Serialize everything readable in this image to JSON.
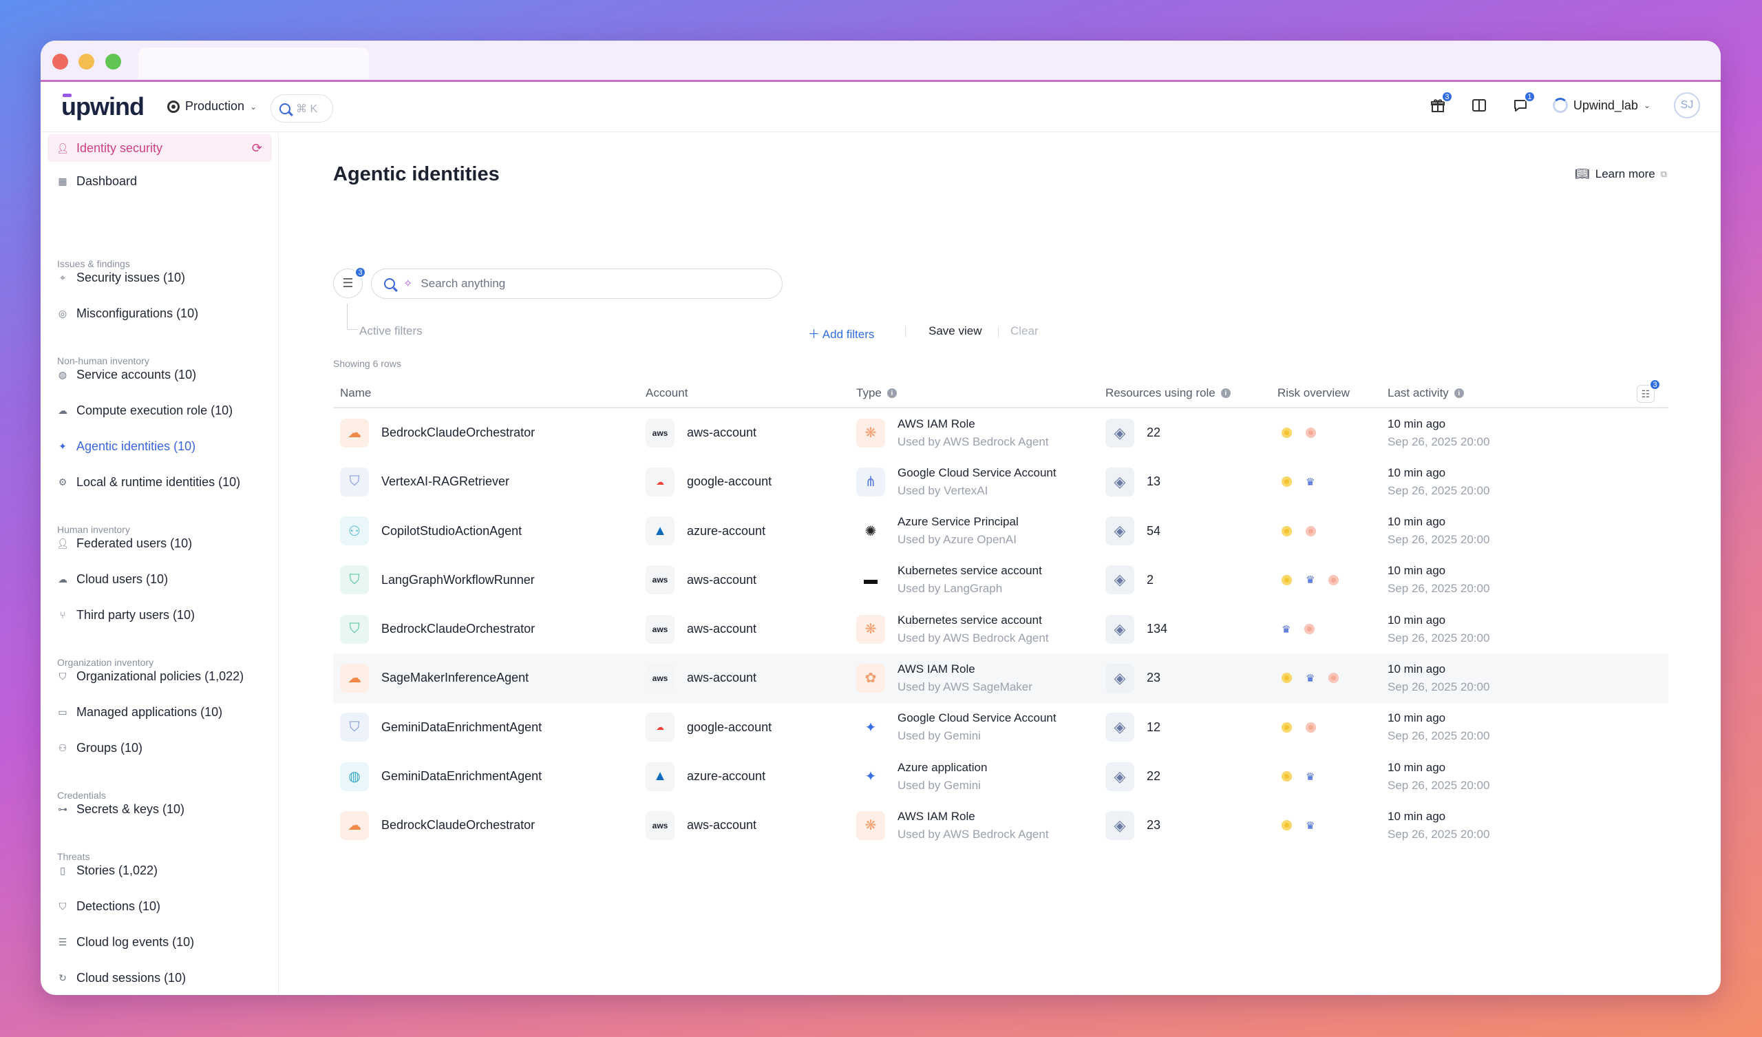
{
  "browser": {
    "traffic": [
      "close",
      "minimize",
      "maximize"
    ]
  },
  "topbar": {
    "logo": "upwind",
    "environment": "Production",
    "search_shortcut": "⌘ K",
    "gift_badge": "3",
    "chat_badge": "1",
    "org_name": "Upwind_lab",
    "avatar_initials": "SJ"
  },
  "sidebar": {
    "active": "Identity security",
    "dashboard": "Dashboard",
    "sections": {
      "issues": "Issues & findings",
      "nonhuman": "Non-human inventory",
      "human": "Human inventory",
      "org": "Organization inventory",
      "credentials": "Credentials",
      "threats": "Threats"
    },
    "items": {
      "security_issues": "Security issues (10)",
      "misconfigurations": "Misconfigurations (10)",
      "service_accounts": "Service accounts (10)",
      "compute_role": "Compute execution role (10)",
      "agentic": "Agentic identities (10)",
      "local_runtime": "Local & runtime identities (10)",
      "federated": "Federated users (10)",
      "cloud_users": "Cloud users (10)",
      "third_party": "Third party users (10)",
      "org_policies": "Organizational policies (1,022)",
      "managed_apps": "Managed applications (10)",
      "groups": "Groups (10)",
      "secrets": "Secrets & keys (10)",
      "stories": "Stories (1,022)",
      "detections": "Detections (10)",
      "cloud_log": "Cloud log events (10)",
      "cloud_sessions": "Cloud sessions (10)"
    }
  },
  "main": {
    "title": "Agentic identities",
    "learn_more": "Learn more",
    "filter_badge": "3",
    "search_placeholder": "Search anything",
    "active_filters": "Active filters",
    "add_filters": "Add filters",
    "save_view": "Save view",
    "clear": "Clear",
    "row_count": "Showing 6 rows",
    "columns_badge": "3",
    "headers": {
      "name": "Name",
      "account": "Account",
      "type": "Type",
      "resources": "Resources using role",
      "risk": "Risk overview",
      "activity": "Last activity"
    },
    "rows": [
      {
        "name": "BedrockClaudeOrchestrator",
        "account": "aws-account",
        "type": "AWS IAM Role",
        "used_by": "Used by AWS Bedrock Agent",
        "resources": "22",
        "last": "10 min ago",
        "date": "Sep 26, 2025 20:00"
      },
      {
        "name": "VertexAI-RAGRetriever",
        "account": "google-account",
        "type": "Google Cloud Service Account",
        "used_by": "Used by VertexAI",
        "resources": "13",
        "last": "10 min ago",
        "date": "Sep 26, 2025 20:00"
      },
      {
        "name": "CopilotStudioActionAgent",
        "account": "azure-account",
        "type": "Azure Service Principal",
        "used_by": "Used by Azure OpenAI",
        "resources": "54",
        "last": "10 min ago",
        "date": "Sep 26, 2025 20:00"
      },
      {
        "name": "LangGraphWorkflowRunner",
        "account": "aws-account",
        "type": "Kubernetes service account",
        "used_by": "Used by LangGraph",
        "resources": "2",
        "last": "10 min ago",
        "date": "Sep 26, 2025 20:00"
      },
      {
        "name": "BedrockClaudeOrchestrator",
        "account": "aws-account",
        "type": "Kubernetes service account",
        "used_by": "Used by AWS Bedrock Agent",
        "resources": "134",
        "last": "10 min ago",
        "date": "Sep 26, 2025 20:00"
      },
      {
        "name": "SageMakerInferenceAgent",
        "account": "aws-account",
        "type": "AWS IAM Role",
        "used_by": "Used by AWS SageMaker",
        "resources": "23",
        "last": "10 min ago",
        "date": "Sep 26, 2025 20:00"
      },
      {
        "name": "GeminiDataEnrichmentAgent",
        "account": "google-account",
        "type": "Google Cloud Service Account",
        "used_by": "Used by Gemini",
        "resources": "12",
        "last": "10 min ago",
        "date": "Sep 26, 2025 20:00"
      },
      {
        "name": "GeminiDataEnrichmentAgent",
        "account": "azure-account",
        "type": "Azure application",
        "used_by": "Used by Gemini",
        "resources": "22",
        "last": "10 min ago",
        "date": "Sep 26, 2025 20:00"
      },
      {
        "name": "BedrockClaudeOrchestrator",
        "account": "aws-account",
        "type": "AWS IAM Role",
        "used_by": "Used by AWS Bedrock Agent",
        "resources": "23",
        "last": "10 min ago",
        "date": "Sep 26, 2025 20:00"
      }
    ]
  },
  "aws_label": "aws"
}
